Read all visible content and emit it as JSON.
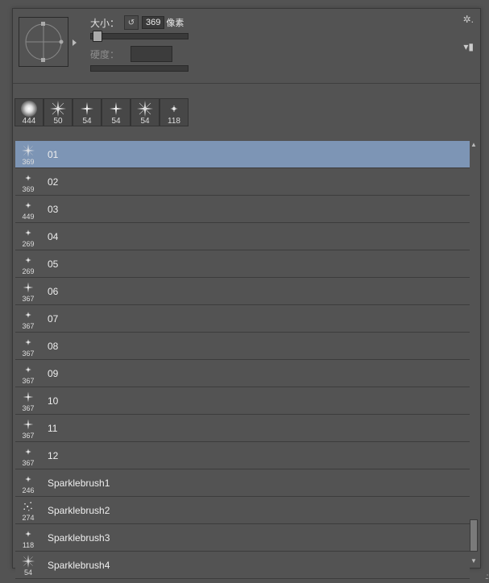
{
  "header": {
    "size_label": "大小：",
    "size_value": "369",
    "size_unit": "像素",
    "hardness_label": "硬度："
  },
  "thumb_strip": [
    {
      "size": "444",
      "icon": "glow"
    },
    {
      "size": "50",
      "icon": "star4"
    },
    {
      "size": "54",
      "icon": "sparkle"
    },
    {
      "size": "54",
      "icon": "sparkle"
    },
    {
      "size": "54",
      "icon": "star4"
    },
    {
      "size": "118",
      "icon": "dot"
    }
  ],
  "brushes": [
    {
      "name": "01",
      "size": "369",
      "icon": "star4",
      "selected": true
    },
    {
      "name": "02",
      "size": "369",
      "icon": "dot"
    },
    {
      "name": "03",
      "size": "449",
      "icon": "dot"
    },
    {
      "name": "04",
      "size": "269",
      "icon": "dot"
    },
    {
      "name": "05",
      "size": "269",
      "icon": "dot"
    },
    {
      "name": "06",
      "size": "367",
      "icon": "sparkle"
    },
    {
      "name": "07",
      "size": "367",
      "icon": "dot"
    },
    {
      "name": "08",
      "size": "367",
      "icon": "dot"
    },
    {
      "name": "09",
      "size": "367",
      "icon": "dot"
    },
    {
      "name": "10",
      "size": "367",
      "icon": "sparkle"
    },
    {
      "name": "11",
      "size": "367",
      "icon": "sparkle"
    },
    {
      "name": "12",
      "size": "367",
      "icon": "dot"
    },
    {
      "name": "Sparklebrush1",
      "size": "246",
      "icon": "dot"
    },
    {
      "name": "Sparklebrush2",
      "size": "274",
      "icon": "multi"
    },
    {
      "name": "Sparklebrush3",
      "size": "118",
      "icon": "dot"
    },
    {
      "name": "Sparklebrush4",
      "size": "54",
      "icon": "star4"
    }
  ]
}
